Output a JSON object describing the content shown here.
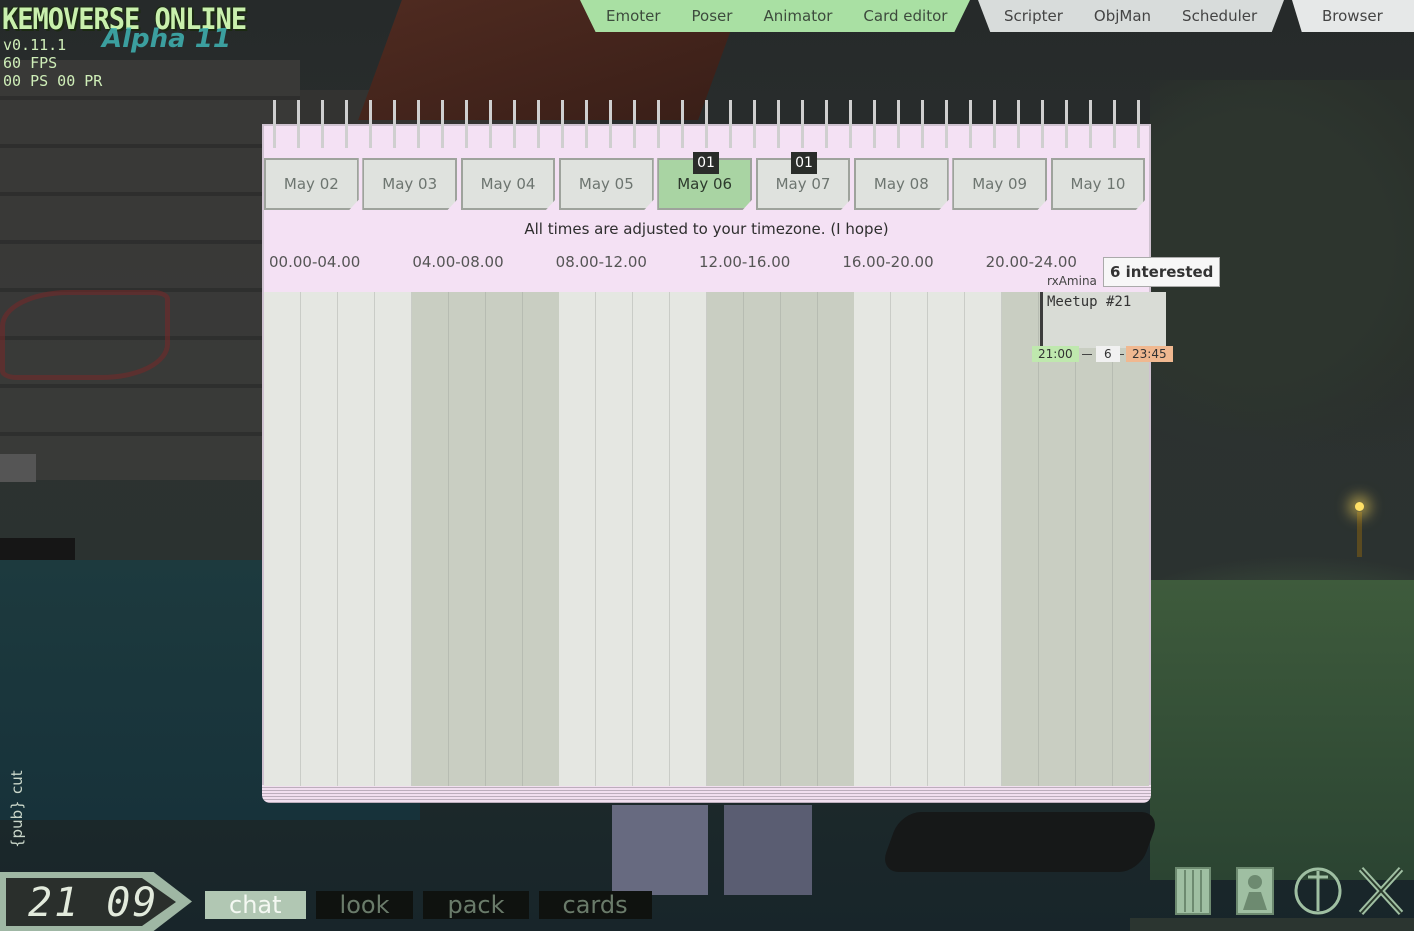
{
  "game": {
    "title": "KEMOVERSE ONLINE",
    "subtitle": "Alpha 11",
    "version": "v0.11.1",
    "fps": "60 FPS",
    "net": "00 PS 00 PR"
  },
  "top_tabs": {
    "group_green": [
      "Emoter",
      "Poser",
      "Animator",
      "Card editor"
    ],
    "group_grey": [
      "Scripter",
      "ObjMan",
      "Scheduler"
    ],
    "browser": "Browser"
  },
  "calendar": {
    "days": [
      {
        "label": "May 02",
        "badge": ""
      },
      {
        "label": "May 03",
        "badge": ""
      },
      {
        "label": "May 04",
        "badge": ""
      },
      {
        "label": "May 05",
        "badge": ""
      },
      {
        "label": "May 06",
        "badge": "01",
        "active": true
      },
      {
        "label": "May 07",
        "badge": "01"
      },
      {
        "label": "May 08",
        "badge": ""
      },
      {
        "label": "May 09",
        "badge": ""
      },
      {
        "label": "May 10",
        "badge": ""
      }
    ],
    "notice": "All times are adjusted to your timezone. (I hope)",
    "time_slots": [
      "00.00-04.00",
      "04.00-08.00",
      "08.00-12.00",
      "12.00-16.00",
      "16.00-20.00",
      "20.00-24.00"
    ],
    "event": {
      "owner": "rxAmina",
      "title": "Meetup #21",
      "start": "21:00",
      "count": "6",
      "end": "23:45",
      "tooltip": "6 interested"
    }
  },
  "hud": {
    "clock": "21 09",
    "bottom_tabs": [
      "chat",
      "look",
      "pack",
      "cards"
    ],
    "active_bottom_tab": "chat",
    "side_labels": [
      "cut",
      "{pub}"
    ]
  },
  "colors": {
    "accent_green": "#a9e0a3",
    "paper": "#f4e1f4",
    "start_time": "#bfe8ae",
    "end_time": "#f0b890"
  }
}
